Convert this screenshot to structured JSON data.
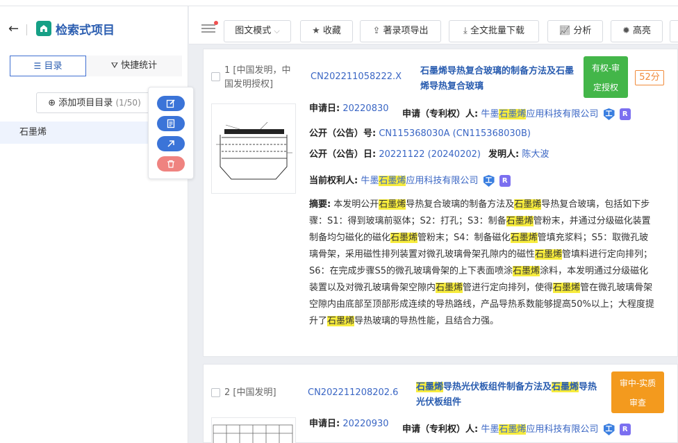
{
  "app": {
    "title": "检索式项目",
    "back_glyph": "←"
  },
  "sidebar": {
    "tabs": [
      {
        "label": "目录"
      },
      {
        "label": "快捷统计"
      }
    ],
    "add_button": {
      "label": "添加项目目录",
      "count": "(1/50)"
    },
    "items": [
      {
        "label": "石墨烯"
      }
    ]
  },
  "toolbar": {
    "view_mode": "图文模式",
    "buttons": {
      "favorite": "收藏",
      "export": "著录项导出",
      "download": "全文批量下载",
      "analyze": "分析",
      "highlight": "高亮"
    }
  },
  "results": [
    {
      "index": "1",
      "type": "[中国发明，中国发明授权]",
      "pub_no": "CN202211058222.X",
      "title_parts": [
        "石墨烯",
        "导热复合玻璃的制备方法及",
        "石墨烯",
        "导热复合玻璃"
      ],
      "status": [
        "有权-审",
        "定授权"
      ],
      "status_color": "#43b649",
      "score": "52分",
      "apply_label": "申请日:",
      "apply_date": "20220830",
      "applicant_label": "申请（专利权）人:",
      "applicant_parts": [
        "牛墨",
        "石墨烯",
        "应用科技有限公司"
      ],
      "publication_label": "公开（公告）号:",
      "publication_no": "CN115368030A",
      "publication_no2": "(CN115368030B)",
      "publication_date_label": "公开（公告）日:",
      "publication_date": "20221122",
      "publication_date2": "(20240202)",
      "inventor_label": "发明人:",
      "inventor": "陈大波",
      "owner_label": "当前权利人:",
      "owner_parts": [
        "牛墨",
        "石墨烯",
        "应用科技有限公司"
      ],
      "abstract_label": "摘要:",
      "abstract_parts": [
        "本发明公开",
        "石墨烯",
        "导热复合玻璃的制备方法及",
        "石墨烯",
        "导热复合玻璃，包括如下步骤：S1：得到玻璃前驱体；S2：打孔；S3：制备",
        "石墨烯",
        "管粉末，并通过分级磁化装置制备均匀磁化的磁化",
        "石墨烯",
        "管粉末；S4：制备磁化",
        "石墨烯",
        "管填充浆料；S5：取微孔玻璃骨架，采用磁性排列装置对微孔玻璃骨架孔隙内的磁性",
        "石墨烯",
        "管填料进行定向排列；S6：在完成步骤S5的微孔玻璃骨架的上下表面喷涂",
        "石墨烯",
        "涂料，本发明通过分级磁化装置以及对微孔玻璃骨架空隙内",
        "石墨烯",
        "管进行定向排列，使得",
        "石墨烯",
        "管在微孔玻璃骨架空隙内由底部至顶部形成连续的导热路线，产品导热系数能够提高50%以上；大程度提升了",
        "石墨烯",
        "导热玻璃的导热性能，且结合力强。"
      ]
    },
    {
      "index": "2",
      "type": "[中国发明]",
      "pub_no": "CN202211208202.6",
      "title_parts": [
        "石墨烯",
        "导热光伏板组件制备方法及",
        "石墨烯",
        "导热光伏板组件"
      ],
      "status": [
        "审中-实质",
        "审查"
      ],
      "status_color": "#f39a1e",
      "apply_label": "申请日:",
      "apply_date": "20220930",
      "applicant_label": "申请（专利权）人:",
      "applicant_parts": [
        "牛墨",
        "石墨烯",
        "应用科技有限公司"
      ]
    }
  ],
  "badges": {
    "i": "工",
    "r": "R"
  },
  "colors": {
    "accent": "#2a5db0",
    "highlight": "#f7ec3c"
  }
}
